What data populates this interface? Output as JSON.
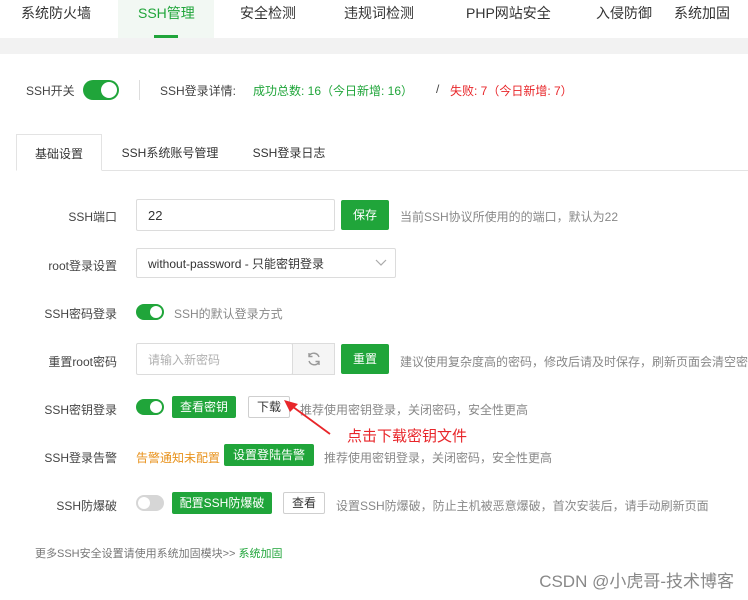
{
  "topnav": {
    "items": [
      {
        "label": "系统防火墙"
      },
      {
        "label": "SSH管理"
      },
      {
        "label": "安全检测"
      },
      {
        "label": "违规词检测"
      },
      {
        "label": "PHP网站安全"
      },
      {
        "label": "入侵防御"
      },
      {
        "label": "系统加固"
      }
    ],
    "active_index": 1
  },
  "header": {
    "ssh_switch_label": "SSH开关",
    "ssh_switch_on": true,
    "login_detail_label": "SSH登录详情:",
    "success_text": "成功总数: 16（今日新增: 16）",
    "separator": "/",
    "fail_text": "失败: 7（今日新增: 7）"
  },
  "tabs": [
    {
      "label": "基础设置",
      "active": true
    },
    {
      "label": "SSH系统账号管理",
      "active": false
    },
    {
      "label": "SSH登录日志",
      "active": false
    }
  ],
  "form": {
    "port": {
      "label": "SSH端口",
      "value": "22",
      "button": "保存",
      "hint": "当前SSH协议所使用的的端口，默认为22"
    },
    "root_login": {
      "label": "root登录设置",
      "value": "without-password - 只能密钥登录"
    },
    "password_login": {
      "label": "SSH密码登录",
      "on": true,
      "hint": "SSH的默认登录方式"
    },
    "reset_root": {
      "label": "重置root密码",
      "placeholder": "请输入新密码",
      "button": "重置",
      "hint": "建议使用复杂度高的密码，修改后请及时保存，刷新页面会清空密码"
    },
    "key_login": {
      "label": "SSH密钥登录",
      "on": true,
      "view_button": "查看密钥",
      "download_button": "下载",
      "hint": "推荐使用密钥登录，关闭密码，安全性更高"
    },
    "login_alert": {
      "label": "SSH登录告警",
      "status": "告警通知未配置",
      "button": "设置登陆告警",
      "hint": "推荐使用密钥登录，关闭密码，安全性更高"
    },
    "anti_brute": {
      "label": "SSH防爆破",
      "on": false,
      "config_button": "配置SSH防爆破",
      "view_button": "查看",
      "hint": "设置SSH防爆破，防止主机被恶意爆破，首次安装后，请手动刷新页面"
    }
  },
  "annotation": {
    "text": "点击下载密钥文件"
  },
  "footer": {
    "text": "更多SSH安全设置请使用系统加固模块>>",
    "link": "系统加固"
  },
  "watermark": "CSDN @小虎哥-技术博客",
  "colors": {
    "accent": "#20a53a",
    "danger": "#e8262a",
    "warning": "#e8921c"
  }
}
